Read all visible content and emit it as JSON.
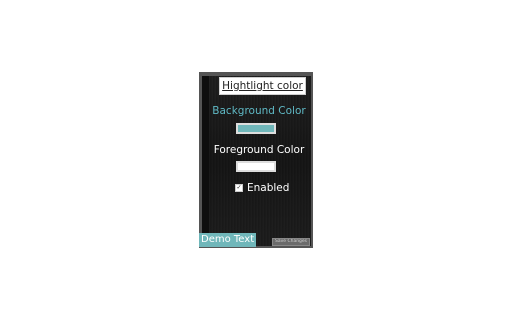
{
  "popup": {
    "title": "Hightlight color",
    "background_label": "Background Color",
    "foreground_label": "Foreground Color",
    "enabled_label": "Enabled",
    "enabled_checked": true,
    "checkbox_mark": "✓",
    "demo_text": "Demo Text",
    "save_label": "Save Changes"
  },
  "colors": {
    "background": "#70b7ba",
    "foreground": "#ffffff",
    "accent_label": "#5fb8c4",
    "panel_frame": "#555555"
  }
}
